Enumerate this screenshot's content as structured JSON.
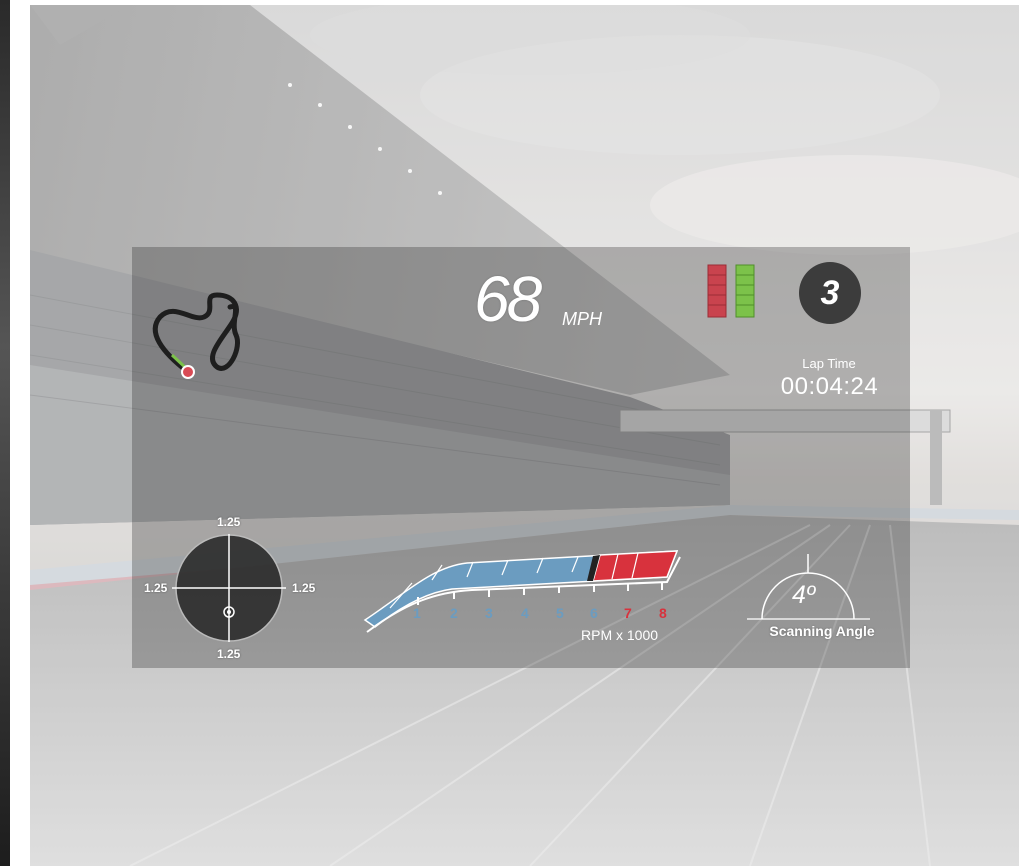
{
  "speed": {
    "value": "68",
    "unit": "MPH"
  },
  "gear": "3",
  "lap": {
    "label": "Lap Time",
    "time": "00:04:24"
  },
  "shift_lights": {
    "left_color": "#c9434e",
    "right_color": "#7cc24a",
    "segments": 5
  },
  "g_force": {
    "top": "1.25",
    "left": "1.25",
    "right": "1.25",
    "bottom": "1.25"
  },
  "rpm": {
    "label": "RPM x 1000",
    "ticks": [
      "1",
      "2",
      "3",
      "4",
      "5",
      "6",
      "7",
      "8"
    ],
    "current": 6.5,
    "normal_color": "#6b9cc0",
    "redline_color": "#d8323d"
  },
  "scan": {
    "angle": "4º",
    "label": "Scanning Angle"
  },
  "track_map": {
    "icon": "track-map-icon",
    "marker_color": "#d94b55",
    "segment_color": "#7cc24a"
  }
}
